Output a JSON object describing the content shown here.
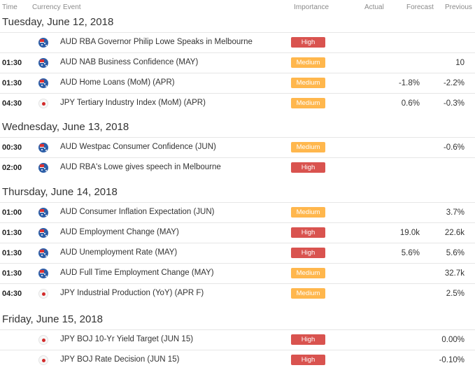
{
  "header": {
    "time": "Time",
    "currency": "Currency",
    "event": "Event",
    "importance": "Importance",
    "actual": "Actual",
    "forecast": "Forecast",
    "previous": "Previous"
  },
  "colors": {
    "high": "#d9534f",
    "medium": "#ffb74d"
  },
  "days": [
    {
      "label": "Tuesday, June 12, 2018",
      "events": [
        {
          "time": "",
          "currency_icon": "australia-flag-icon",
          "event": "AUD RBA Governor Philip Lowe Speaks in Melbourne",
          "importance": "High",
          "actual": "",
          "forecast": "",
          "previous": ""
        },
        {
          "time": "01:30",
          "currency_icon": "australia-flag-icon",
          "event": "AUD NAB Business Confidence (MAY)",
          "importance": "Medium",
          "actual": "",
          "forecast": "",
          "previous": "10"
        },
        {
          "time": "01:30",
          "currency_icon": "australia-flag-icon",
          "event": "AUD Home Loans (MoM) (APR)",
          "importance": "Medium",
          "actual": "",
          "forecast": "-1.8%",
          "previous": "-2.2%"
        },
        {
          "time": "04:30",
          "currency_icon": "japan-flag-icon",
          "event": "JPY Tertiary Industry Index (MoM) (APR)",
          "importance": "Medium",
          "actual": "",
          "forecast": "0.6%",
          "previous": "-0.3%"
        }
      ]
    },
    {
      "label": "Wednesday, June 13, 2018",
      "events": [
        {
          "time": "00:30",
          "currency_icon": "australia-flag-icon",
          "event": "AUD Westpac Consumer Confidence (JUN)",
          "importance": "Medium",
          "actual": "",
          "forecast": "",
          "previous": "-0.6%"
        },
        {
          "time": "02:00",
          "currency_icon": "australia-flag-icon",
          "event": "AUD RBA's Lowe gives speech in Melbourne",
          "importance": "High",
          "actual": "",
          "forecast": "",
          "previous": ""
        }
      ]
    },
    {
      "label": "Thursday, June 14, 2018",
      "events": [
        {
          "time": "01:00",
          "currency_icon": "australia-flag-icon",
          "event": "AUD Consumer Inflation Expectation (JUN)",
          "importance": "Medium",
          "actual": "",
          "forecast": "",
          "previous": "3.7%"
        },
        {
          "time": "01:30",
          "currency_icon": "australia-flag-icon",
          "event": "AUD Employment Change (MAY)",
          "importance": "High",
          "actual": "",
          "forecast": "19.0k",
          "previous": "22.6k"
        },
        {
          "time": "01:30",
          "currency_icon": "australia-flag-icon",
          "event": "AUD Unemployment Rate (MAY)",
          "importance": "High",
          "actual": "",
          "forecast": "5.6%",
          "previous": "5.6%"
        },
        {
          "time": "01:30",
          "currency_icon": "australia-flag-icon",
          "event": "AUD Full Time Employment Change (MAY)",
          "importance": "Medium",
          "actual": "",
          "forecast": "",
          "previous": "32.7k"
        },
        {
          "time": "04:30",
          "currency_icon": "japan-flag-icon",
          "event": "JPY Industrial Production (YoY) (APR F)",
          "importance": "Medium",
          "actual": "",
          "forecast": "",
          "previous": "2.5%"
        }
      ]
    },
    {
      "label": "Friday, June 15, 2018",
      "events": [
        {
          "time": "",
          "currency_icon": "japan-flag-icon",
          "event": "JPY BOJ 10-Yr Yield Target (JUN 15)",
          "importance": "High",
          "actual": "",
          "forecast": "",
          "previous": "0.00%"
        },
        {
          "time": "",
          "currency_icon": "japan-flag-icon",
          "event": "JPY BOJ Rate Decision (JUN 15)",
          "importance": "High",
          "actual": "",
          "forecast": "",
          "previous": "-0.10%"
        }
      ]
    }
  ]
}
